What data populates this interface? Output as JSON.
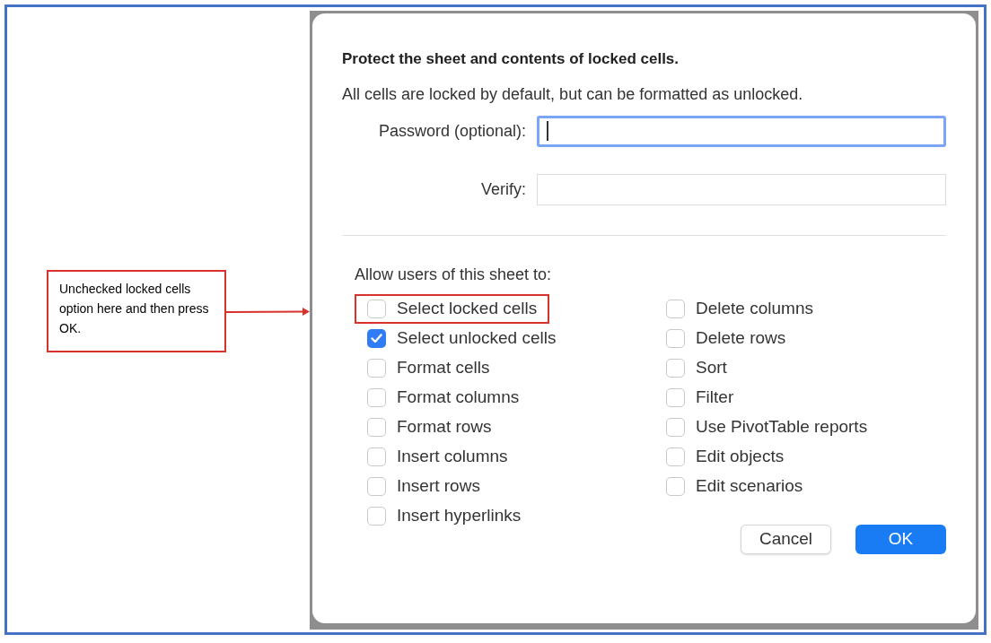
{
  "annotation": {
    "text": "Unchecked locked cells option here and then press OK."
  },
  "dialog": {
    "title": "Protect the sheet and contents of locked cells.",
    "description": "All cells are locked by default, but can be formatted as unlocked.",
    "fields": [
      {
        "label": "Password (optional):",
        "focused": true
      },
      {
        "label": "Verify:",
        "focused": false
      }
    ],
    "allow_label": "Allow users of this sheet to:",
    "left_options": [
      {
        "label": "Select locked cells",
        "checked": false,
        "highlighted": true
      },
      {
        "label": "Select unlocked cells",
        "checked": true,
        "highlighted": false
      },
      {
        "label": "Format cells",
        "checked": false,
        "highlighted": false
      },
      {
        "label": "Format columns",
        "checked": false,
        "highlighted": false
      },
      {
        "label": "Format rows",
        "checked": false,
        "highlighted": false
      },
      {
        "label": "Insert columns",
        "checked": false,
        "highlighted": false
      },
      {
        "label": "Insert rows",
        "checked": false,
        "highlighted": false
      },
      {
        "label": "Insert hyperlinks",
        "checked": false,
        "highlighted": false
      }
    ],
    "right_options": [
      {
        "label": "Delete columns",
        "checked": false,
        "highlighted": false
      },
      {
        "label": "Delete rows",
        "checked": false,
        "highlighted": false
      },
      {
        "label": "Sort",
        "checked": false,
        "highlighted": false
      },
      {
        "label": "Filter",
        "checked": false,
        "highlighted": false
      },
      {
        "label": "Use PivotTable reports",
        "checked": false,
        "highlighted": false
      },
      {
        "label": "Edit objects",
        "checked": false,
        "highlighted": false
      },
      {
        "label": "Edit scenarios",
        "checked": false,
        "highlighted": false
      }
    ],
    "buttons": [
      {
        "label": "Cancel",
        "kind": "secondary"
      },
      {
        "label": "OK",
        "kind": "primary"
      }
    ]
  }
}
